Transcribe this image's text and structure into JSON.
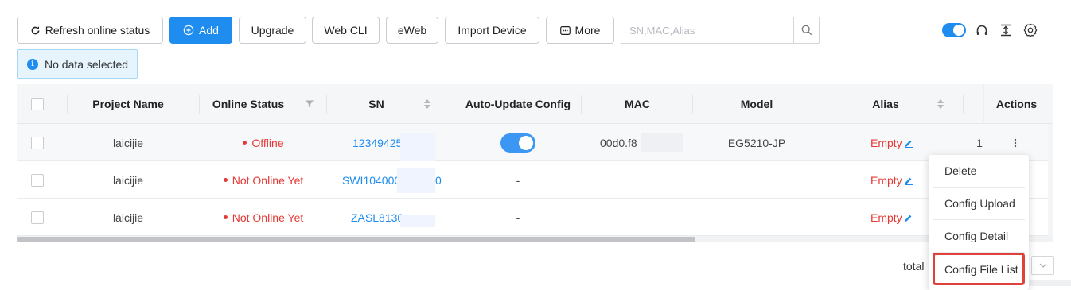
{
  "toolbar": {
    "refresh_label": "Refresh online status",
    "add_label": "Add",
    "upgrade_label": "Upgrade",
    "webcli_label": "Web CLI",
    "eweb_label": "eWeb",
    "import_label": "Import Device",
    "more_label": "More",
    "search_placeholder": "SN,MAC,Alias",
    "toggle_on": true
  },
  "alert": {
    "text": "No data selected"
  },
  "table": {
    "headers": {
      "project": "Project Name",
      "online": "Online Status",
      "sn": "SN",
      "autoupdate": "Auto-Update Config",
      "mac": "MAC",
      "model": "Model",
      "alias": "Alias",
      "actions": "Actions"
    },
    "rows": [
      {
        "project": "laicijie",
        "status": "Offline",
        "sn": "12349425",
        "autoupdate": "on",
        "mac": "00d0.f8",
        "model": "EG5210-JP",
        "alias": "Empty",
        "extra": "1"
      },
      {
        "project": "laicijie",
        "status": "Not Online Yet",
        "sn": "SWI104000",
        "sn_tail": "0",
        "autoupdate": "-",
        "mac": "",
        "model": "",
        "alias": "Empty"
      },
      {
        "project": "laicijie",
        "status": "Not Online Yet",
        "sn": "ZASL8130",
        "autoupdate": "-",
        "mac": "",
        "model": "",
        "alias": "Empty"
      }
    ]
  },
  "menu": {
    "items": [
      "Delete",
      "Config Upload",
      "Config Detail",
      "Config File List"
    ]
  },
  "pager": {
    "total_label": "total"
  },
  "colors": {
    "primary": "#1f8cf0",
    "danger": "#e53935",
    "highlight": "#e0413a"
  },
  "icons": [
    "refresh-icon",
    "plus-circle-icon",
    "more-dots-icon",
    "search-icon",
    "headset-icon",
    "vertical-align-icon",
    "gear-icon",
    "info-icon",
    "filter-icon",
    "sort-icon",
    "edit-icon",
    "kebab-icon",
    "chevron-down-icon"
  ]
}
